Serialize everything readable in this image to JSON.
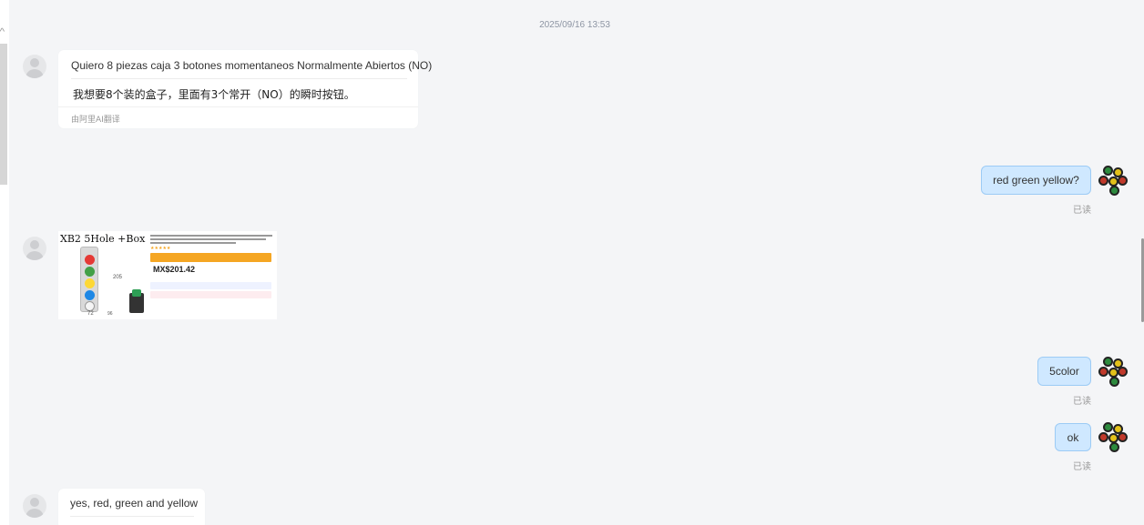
{
  "timestamp": "2025/09/16 13:53",
  "messages": [
    {
      "side": "left",
      "original": "Quiero 8 piezas caja 3 botones momentaneos Normalmente Abiertos (NO)",
      "translated": "我想要8个装的盒子，里面有3个常开（NO）的瞬时按钮。",
      "translate_note": "由阿里AI翻译"
    },
    {
      "side": "right",
      "text": "red green yellow?",
      "status": "已读"
    },
    {
      "side": "left",
      "type": "image",
      "image": {
        "title": "XB2 5Hole +Box",
        "dim_width": "72",
        "dim_height": "205",
        "dim_depth": "96",
        "price": "MX$201.42"
      }
    },
    {
      "side": "right",
      "text": "5color",
      "status": "已读"
    },
    {
      "side": "right",
      "text": "ok",
      "status": "已读"
    },
    {
      "side": "left",
      "original": "yes, red, green and yellow"
    }
  ]
}
